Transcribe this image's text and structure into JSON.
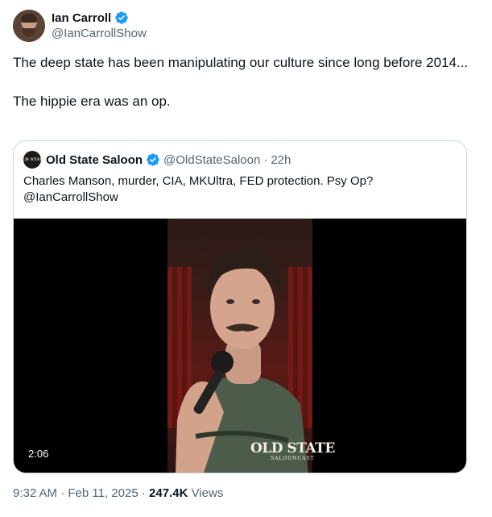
{
  "author": {
    "display_name": "Ian Carroll",
    "handle": "@IanCarrollShow",
    "verified_color": "#1d9bf0"
  },
  "tweet": {
    "paragraph_1": "The deep state has been manipulating our culture since long before 2014...",
    "paragraph_2": "The hippie era was an op."
  },
  "quote": {
    "avatar_text": "OLD STATE",
    "display_name": "Old State Saloon",
    "handle": "@OldStateSaloon",
    "separator": "·",
    "time": "22h",
    "text_line_1": "Charles Manson, murder, CIA, MKUltra, FED protection. Psy Op?",
    "text_line_2": "@IanCarrollShow",
    "video": {
      "duration": "2:06",
      "watermark_title": "OLD STATE",
      "watermark_subtitle": "SALOONCAST"
    }
  },
  "meta": {
    "time": "9:32 AM",
    "sep1": "·",
    "date": "Feb 11, 2025",
    "sep2": "·",
    "views_count": "247.4K",
    "views_label": "Views"
  }
}
